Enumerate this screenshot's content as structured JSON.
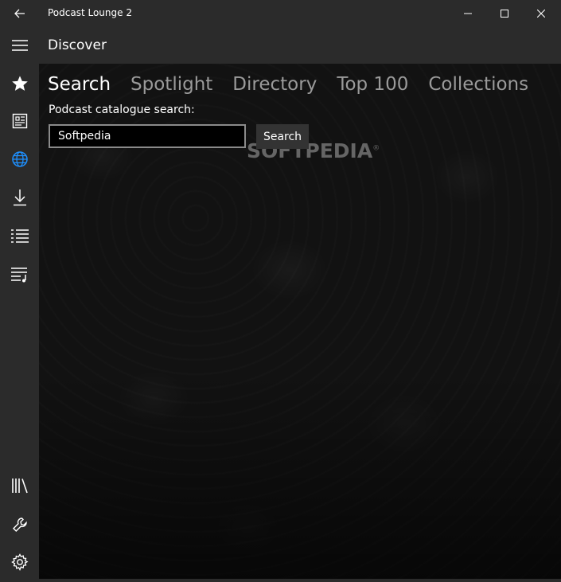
{
  "window": {
    "title": "Podcast Lounge 2"
  },
  "header": {
    "title": "Discover"
  },
  "sidebar": {
    "items": [
      {
        "icon": "star-icon"
      },
      {
        "icon": "podcasts-icon"
      },
      {
        "icon": "globe-icon"
      },
      {
        "icon": "download-icon"
      },
      {
        "icon": "list-icon"
      },
      {
        "icon": "playlist-icon"
      },
      {
        "icon": "library-icon"
      },
      {
        "icon": "wrench-icon"
      },
      {
        "icon": "gear-icon"
      }
    ]
  },
  "tabs": [
    {
      "label": "Search",
      "active": true
    },
    {
      "label": "Spotlight",
      "active": false
    },
    {
      "label": "Directory",
      "active": false
    },
    {
      "label": "Top 100",
      "active": false
    },
    {
      "label": "Collections",
      "active": false
    }
  ],
  "search": {
    "label": "Podcast catalogue search:",
    "value": "Softpedia",
    "button_label": "Search"
  },
  "watermark": {
    "text": "SOFTPEDIA",
    "mark": "®"
  },
  "colors": {
    "accent": "#1e90ff",
    "chrome": "#2b2b2b",
    "inactive_tab": "#9a9a9a"
  }
}
